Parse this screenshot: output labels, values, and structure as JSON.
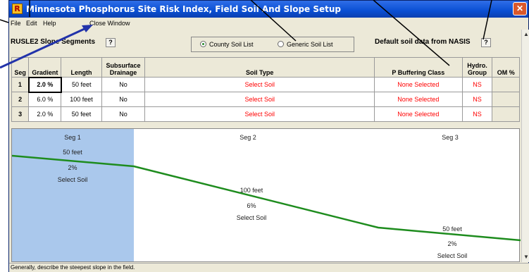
{
  "window": {
    "title": "Minnesota Phosphorus Site Risk Index, Field Soil And Slope Setup",
    "app_icon": "R",
    "close_glyph": "✕"
  },
  "menu": {
    "items": [
      "File",
      "Edit",
      "Help"
    ],
    "close_window": "Close Window"
  },
  "topbar": {
    "segments_title": "RUSLE2 Slope Segments",
    "help_glyph": "?",
    "soil_list_options": [
      {
        "label": "County Soil List",
        "selected": true
      },
      {
        "label": "Generic Soil List",
        "selected": false
      }
    ],
    "nasis_label": "Default soil data from NASIS",
    "nasis_help": "?"
  },
  "grid": {
    "headers": [
      "Seg",
      "Gradient",
      "Length",
      "Subsurface Drainage",
      "Soil Type",
      "P Buffering Class",
      "Hydro. Group",
      "OM %"
    ],
    "rows": [
      {
        "seg": "1",
        "gradient": "2.0 %",
        "length": "50 feet",
        "drainage": "No",
        "soil": "Select Soil",
        "p_class": "None Selected",
        "hydro": "NS",
        "om": ""
      },
      {
        "seg": "2",
        "gradient": "6.0 %",
        "length": "100 feet",
        "drainage": "No",
        "soil": "Select Soil",
        "p_class": "None Selected",
        "hydro": "NS",
        "om": ""
      },
      {
        "seg": "3",
        "gradient": "2.0 %",
        "length": "50 feet",
        "drainage": "No",
        "soil": "Select Soil",
        "p_class": "None Selected",
        "hydro": "NS",
        "om": ""
      }
    ],
    "selected_row": 0
  },
  "profile": {
    "line_color": "#1e8c1e",
    "selection_color": "#aac8ec",
    "segments": [
      {
        "name": "Seg 1",
        "length": "50 feet",
        "slope": "2%",
        "soil": "Select Soil"
      },
      {
        "name": "Seg 2",
        "length": "100 feet",
        "slope": "6%",
        "soil": "Select Soil"
      },
      {
        "name": "Seg 3",
        "length": "50 feet",
        "slope": "2%",
        "soil": "Select Soil"
      }
    ]
  },
  "status": {
    "text": "Generally, describe the steepest slope in the field."
  },
  "colors": {
    "titlebar": "#0a4fd3",
    "red_text": "#ff0000",
    "annotation_blue": "#2233aa"
  }
}
